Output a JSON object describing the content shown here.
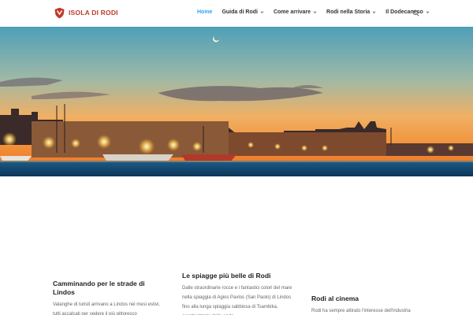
{
  "header": {
    "logo_text": "ISOLA DI RODI",
    "nav": [
      {
        "label": "Home",
        "active": true,
        "dropdown": false
      },
      {
        "label": "Guida di Rodi",
        "active": false,
        "dropdown": true
      },
      {
        "label": "Come arrivare",
        "active": false,
        "dropdown": true
      },
      {
        "label": "Rodi nella Storia",
        "active": false,
        "dropdown": true
      },
      {
        "label": "Il Dodecaneso",
        "active": false,
        "dropdown": true
      }
    ],
    "search_icon": "search-icon"
  },
  "colors": {
    "accent": "#2ea3f2",
    "brand": "#c0392b",
    "heading": "#222222",
    "body_text": "#666666"
  },
  "articles": [
    {
      "title": "Camminando per le strade di Lindos",
      "excerpt": "Valanghe di turisti arrivano a Lindos nei mesi estivi, tutti accalcati per vedere il più pittoresco"
    },
    {
      "title": "Le spiagge più belle di Rodi",
      "excerpt": "Dalle straordinarie rocce e i fantastici colori del mare nella spiaggia di Agios Pavlos (San Paolo) di Lindos fino alla lunga spiaggia sabbiosa di Tsambika, caratterizzata dalle onde"
    },
    {
      "title": "Rodi al cinema",
      "excerpt": "Rodi ha sempre attirato l'interesse dell'industria"
    }
  ]
}
